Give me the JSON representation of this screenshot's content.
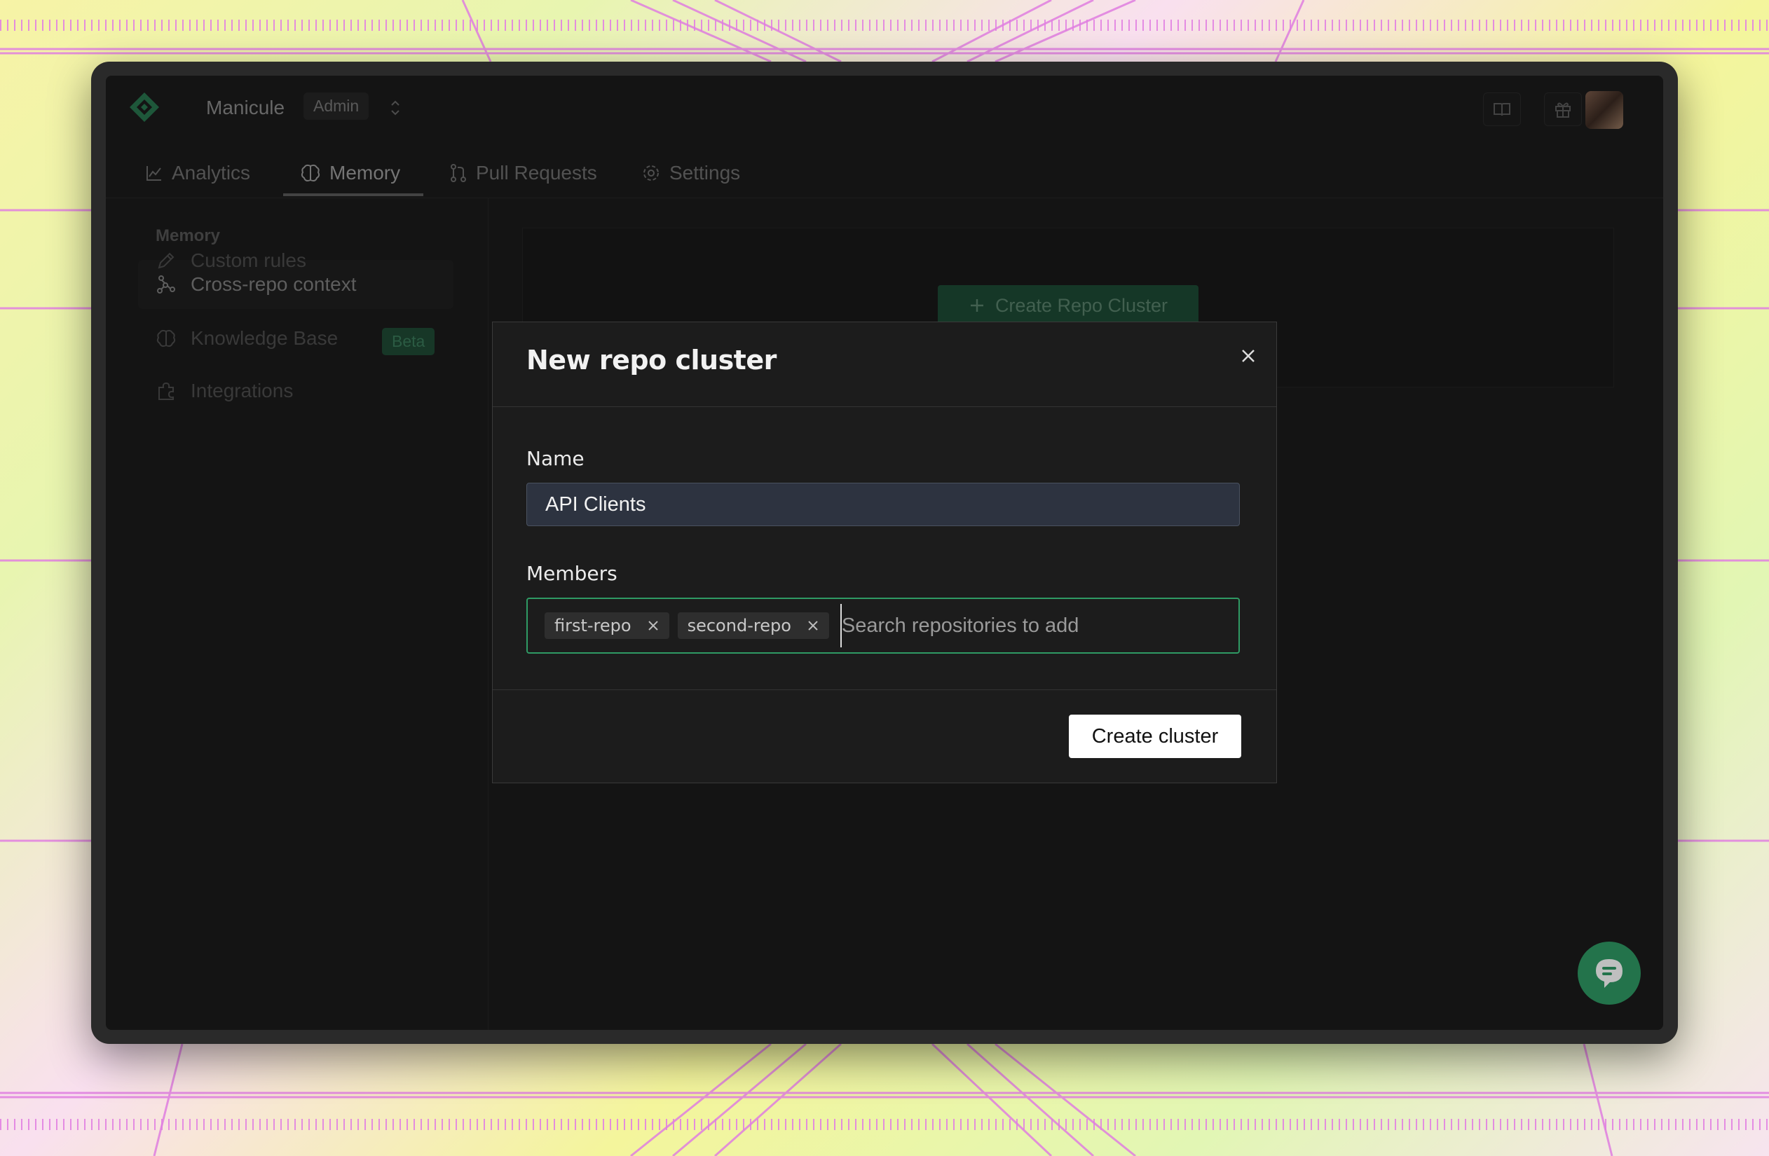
{
  "app": {
    "org_name": "Manicule",
    "role": "Admin"
  },
  "tabs": [
    {
      "label": "Analytics",
      "icon": "chart-line-icon"
    },
    {
      "label": "Memory",
      "icon": "brain-icon",
      "active": true
    },
    {
      "label": "Pull Requests",
      "icon": "git-pull-request-icon"
    },
    {
      "label": "Settings",
      "icon": "gear-icon"
    }
  ],
  "sidebar": {
    "heading": "Memory",
    "items": [
      {
        "label": "Custom rules",
        "icon": "pencil-icon"
      },
      {
        "label": "Cross-repo context",
        "icon": "network-icon",
        "active": true
      },
      {
        "label": "Knowledge Base",
        "icon": "brain-icon",
        "badge": "Beta"
      },
      {
        "label": "Integrations",
        "icon": "puzzle-icon"
      }
    ]
  },
  "main": {
    "create_button_label": "Create Repo Cluster"
  },
  "modal": {
    "title": "New repo cluster",
    "name_label": "Name",
    "name_value": "API Clients",
    "members_label": "Members",
    "members": [
      "first-repo",
      "second-repo"
    ],
    "members_placeholder": "Search repositories to add",
    "submit_label": "Create cluster"
  },
  "colors": {
    "accent": "#2f9a64",
    "background": "#1b1b1b",
    "modal_bg": "#1c1c1c"
  }
}
